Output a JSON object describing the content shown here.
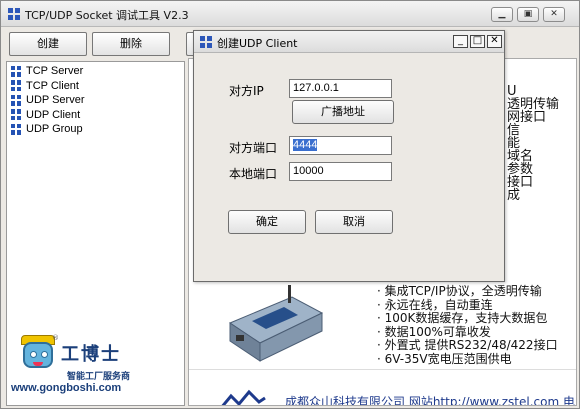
{
  "window": {
    "title": "TCP/UDP Socket 调试工具 V2.3"
  },
  "toolbar": {
    "create_label": "创建",
    "delete_label": "删除"
  },
  "tree": {
    "items": [
      {
        "label": "TCP Server"
      },
      {
        "label": "TCP Client"
      },
      {
        "label": "UDP Server"
      },
      {
        "label": "UDP Client"
      },
      {
        "label": "UDP Group"
      }
    ]
  },
  "logo": {
    "name": "工博士",
    "subtitle": "智能工厂服务商",
    "url": "www.gongboshi.com",
    "reg": "®"
  },
  "background_panel": {
    "side_lines": [
      "U",
      "透明传输",
      "网接口",
      "信",
      "能",
      "域名",
      "参数",
      "接口",
      "成"
    ],
    "features": [
      "· 集成TCP/IP协议，全透明传输",
      "· 永远在线，自动重连",
      "· 100K数据缓存，支持大数据包",
      "· 数据100%可靠收发",
      "· 外置式 提供RS232/48/422接口",
      "· 6V-35V宽电压范围供电"
    ],
    "company_line": "成都众山科技有限公司    网站http://www.zstel.com    电"
  },
  "dialog": {
    "title": "创建UDP Client",
    "remote_ip_label": "对方IP",
    "remote_ip_value": "127.0.0.1",
    "broadcast_label": "广播地址",
    "remote_port_label": "对方端口",
    "remote_port_value": "4444",
    "local_port_label": "本地端口",
    "local_port_value": "10000",
    "ok_label": "确定",
    "cancel_label": "取消"
  }
}
